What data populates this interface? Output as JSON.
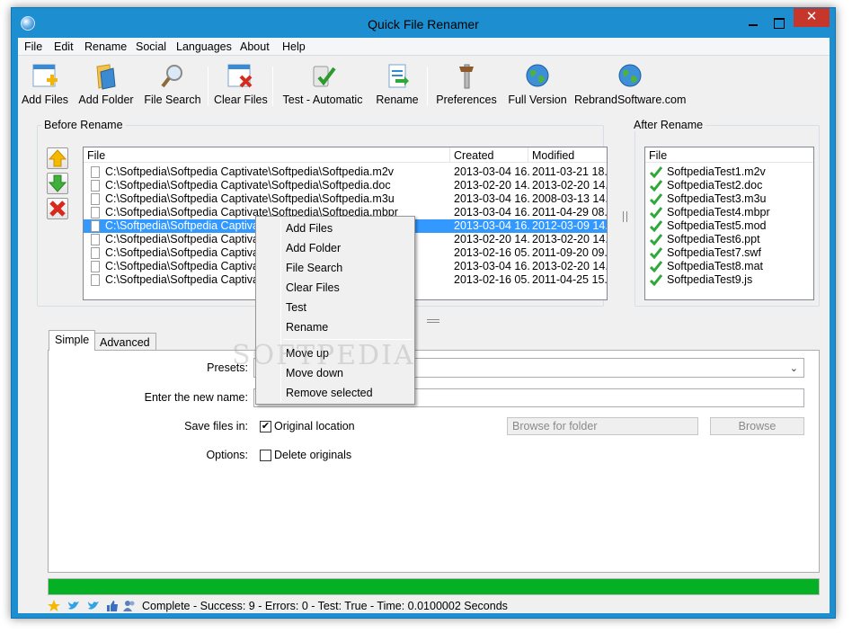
{
  "window": {
    "title": "Quick File Renamer"
  },
  "menubar": [
    "File",
    "Edit",
    "Rename",
    "Social",
    "Languages",
    "About",
    "Help"
  ],
  "toolbar": {
    "add_files": "Add Files",
    "add_folder": "Add Folder",
    "file_search": "File Search",
    "clear_files": "Clear Files",
    "test_automatic": "Test - Automatic",
    "rename": "Rename",
    "preferences": "Preferences",
    "full_version": "Full Version",
    "rebrand": "RebrandSoftware.com"
  },
  "before": {
    "label": "Before Rename",
    "columns": [
      "File",
      "Created",
      "Modified"
    ],
    "rows": [
      {
        "file": "C:\\Softpedia\\Softpedia Captivate\\Softpedia\\Softpedia.m2v",
        "created": "2013-03-04 16...",
        "modified": "2011-03-21 18..."
      },
      {
        "file": "C:\\Softpedia\\Softpedia Captivate\\Softpedia\\Softpedia.doc",
        "created": "2013-02-20 14...",
        "modified": "2013-02-20 14..."
      },
      {
        "file": "C:\\Softpedia\\Softpedia Captivate\\Softpedia\\Softpedia.m3u",
        "created": "2013-03-04 16...",
        "modified": "2008-03-13 14..."
      },
      {
        "file": "C:\\Softpedia\\Softpedia Captivate\\Softpedia\\Softpedia.mbpr",
        "created": "2013-03-04 16...",
        "modified": "2011-04-29 08..."
      },
      {
        "file": "C:\\Softpedia\\Softpedia Captivate\\Softpedia\\Softpedia.mod",
        "created": "2013-03-04 16...",
        "modified": "2012-03-09 14..."
      },
      {
        "file": "C:\\Softpedia\\Softpedia Captivate\\Softpedia\\Softpedia.ppt",
        "created": "2013-02-20 14...",
        "modified": "2013-02-20 14..."
      },
      {
        "file": "C:\\Softpedia\\Softpedia Captivate\\Softpedia\\Softpedia.swf",
        "created": "2013-02-16 05...",
        "modified": "2011-09-20 09..."
      },
      {
        "file": "C:\\Softpedia\\Softpedia Captivate\\Softpedia\\Softpedia.mat",
        "created": "2013-03-04 16...",
        "modified": "2013-02-20 14..."
      },
      {
        "file": "C:\\Softpedia\\Softpedia Captivate\\Softpedia\\Softpedia.js",
        "created": "2013-02-16 05...",
        "modified": "2011-04-25 15..."
      }
    ]
  },
  "after": {
    "label": "After Rename",
    "columns": [
      "File"
    ],
    "rows": [
      "SoftpediaTest1.m2v",
      "SoftpediaTest2.doc",
      "SoftpediaTest3.m3u",
      "SoftpediaTest4.mbpr",
      "SoftpediaTest5.mod",
      "SoftpediaTest6.ppt",
      "SoftpediaTest7.swf",
      "SoftpediaTest8.mat",
      "SoftpediaTest9.js"
    ]
  },
  "tabs": [
    "Simple",
    "Advanced"
  ],
  "form": {
    "presets_label": "Presets:",
    "new_name_label": "Enter the new name:",
    "save_label": "Save files in:",
    "original_location": "Original location",
    "browse_folder": "Browse for folder",
    "browse": "Browse",
    "options_label": "Options:",
    "delete_originals": "Delete originals"
  },
  "progress": 1.0,
  "status": "Complete - Success: 9 - Errors: 0 - Test: True - Time: 0.0100002 Seconds",
  "context_menu": [
    "Add Files",
    "Add Folder",
    "File Search",
    "Clear Files",
    "Test",
    "Rename",
    "Move up",
    "Move down",
    "Remove selected"
  ],
  "watermark": "SOFTPEDIA",
  "colors": {
    "selection": "#3399ff",
    "progress": "#06b025",
    "titlebar": "#1d8ed0",
    "close": "#c7362b"
  }
}
